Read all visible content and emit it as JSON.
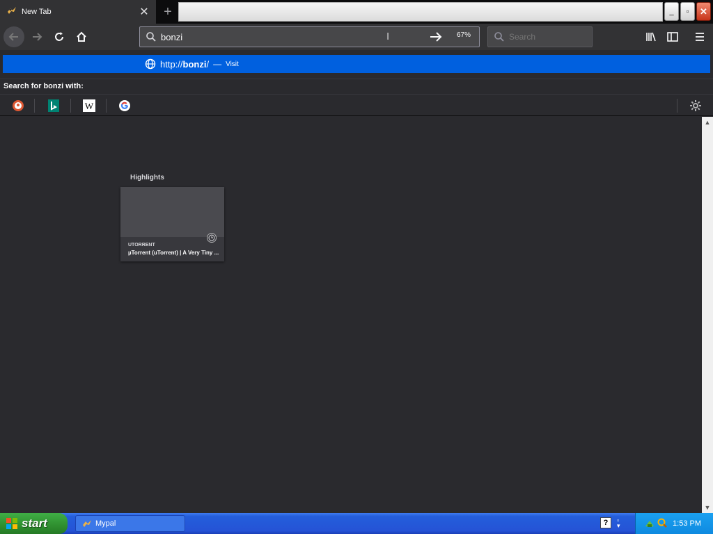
{
  "tab": {
    "title": "New Tab",
    "close": "✕",
    "new_tab": "+"
  },
  "window": {
    "minimize": "_",
    "restore": "▫",
    "close": "✕"
  },
  "nav": {
    "url_value": "bonzi",
    "zoom": "67%",
    "search_placeholder": "Search"
  },
  "popup": {
    "url_prefix": "http://",
    "url_bold": "bonzi",
    "url_suffix": "/",
    "separator": "—",
    "visit": "Visit",
    "search_with": "Search for bonzi with:"
  },
  "engines": [
    "duckduckgo-icon",
    "bing-icon",
    "wikipedia-icon",
    "google-icon"
  ],
  "highlights": {
    "label": "Highlights",
    "card": {
      "source": "UTORRENT",
      "title": "µTorrent (uTorrent) | A Very Tiny ..."
    }
  },
  "taskbar": {
    "start": "start",
    "task_label": "Mypal",
    "help": "?",
    "clock": "1:53 PM"
  },
  "colors": {
    "accent": "#0060df",
    "toolbar": "#323234",
    "content_bg": "#2a2a2e"
  }
}
